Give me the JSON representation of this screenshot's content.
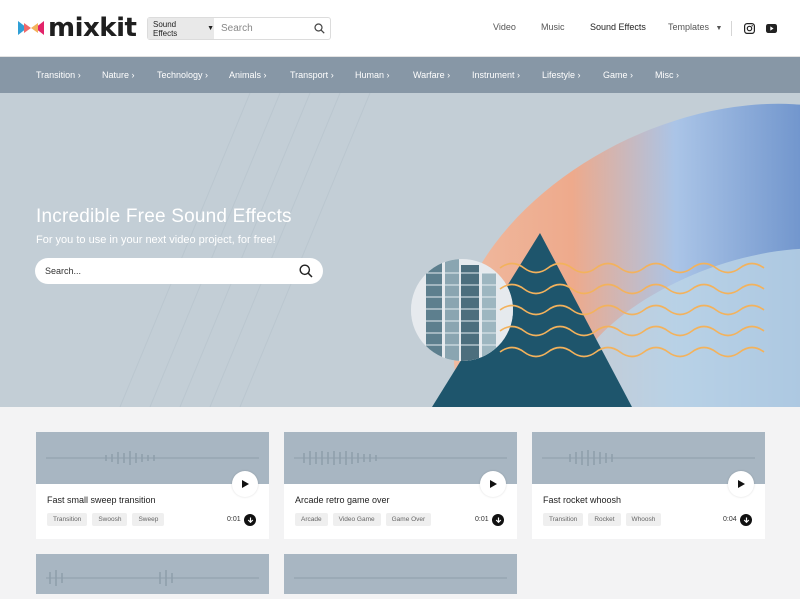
{
  "header": {
    "logo_text": "mixkit",
    "search_type": "Sound Effects",
    "search_placeholder": "Search",
    "nav": {
      "video": "Video",
      "music": "Music",
      "sound_effects": "Sound Effects",
      "templates": "Templates"
    }
  },
  "categories": {
    "transition": "Transition",
    "nature": "Nature",
    "technology": "Technology",
    "animals": "Animals",
    "transport": "Transport",
    "human": "Human",
    "warfare": "Warfare",
    "instrument": "Instrument",
    "lifestyle": "Lifestyle",
    "game": "Game",
    "misc": "Misc"
  },
  "hero": {
    "title": "Incredible Free Sound Effects",
    "subtitle": "For you to use in your next video project, for free!",
    "search_placeholder": "Search..."
  },
  "cards": [
    {
      "title": "Fast small sweep transition",
      "tags": [
        "Transition",
        "Swoosh",
        "Sweep"
      ],
      "duration": "0:01"
    },
    {
      "title": "Arcade retro game over",
      "tags": [
        "Arcade",
        "Video Game",
        "Game Over"
      ],
      "duration": "0:01"
    },
    {
      "title": "Fast rocket whoosh",
      "tags": [
        "Transition",
        "Rocket",
        "Whoosh"
      ],
      "duration": "0:04"
    }
  ],
  "colors": {
    "category_bar": "#8797a6",
    "hero_bg": "#c3ced6",
    "waveform_bg": "#a8b6c2",
    "deep_teal": "#1e556c",
    "wave_orange": "#f3b25c"
  }
}
